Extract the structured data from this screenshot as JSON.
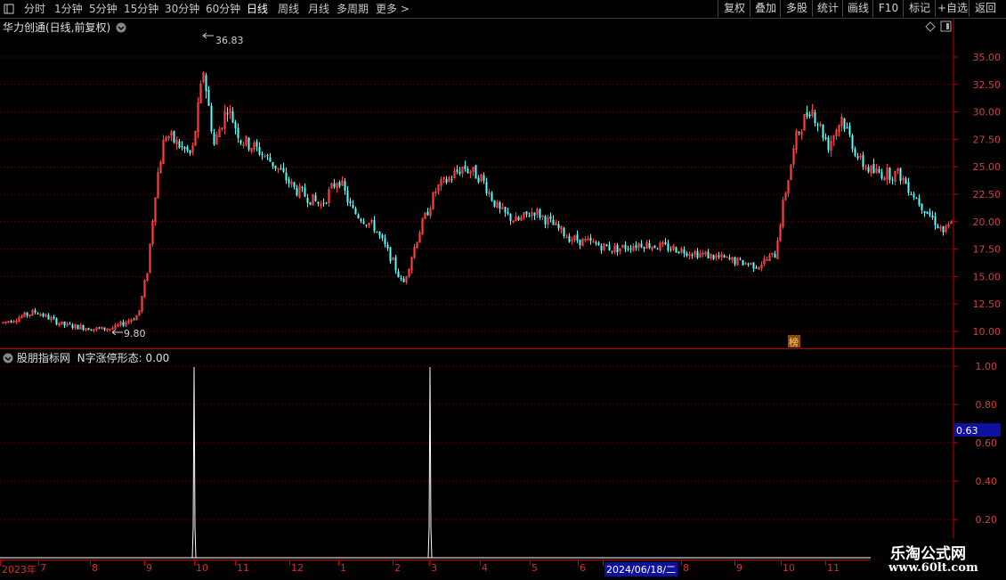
{
  "toolbar": {
    "period_tabs": [
      "分时",
      "1分钟",
      "5分钟",
      "15分钟",
      "30分钟",
      "60分钟",
      "日线",
      "周线",
      "月线",
      "多周期",
      "更多"
    ],
    "active_tab": "日线",
    "right_buttons": [
      "复权",
      "叠加",
      "多股",
      "统计",
      "画线",
      "F10",
      "标记",
      "+自选",
      "返回"
    ]
  },
  "main_panel": {
    "title": "华力创通(日线,前复权)",
    "high_label": "36.83",
    "low_label": "9.80",
    "badge": "榜",
    "y_ticks": [
      "35.00",
      "32.50",
      "30.00",
      "27.50",
      "25.00",
      "22.50",
      "20.00",
      "17.50",
      "15.00",
      "12.50",
      "10.00"
    ]
  },
  "indicator_panel": {
    "title": "股朋指标网",
    "indicator_name": "N字涨停形态:",
    "indicator_value": "0.00",
    "y_ticks": [
      "1.00",
      "0.80",
      "0.60",
      "0.40",
      "0.20"
    ],
    "cursor_value": "0.63"
  },
  "x_axis": {
    "labels": [
      "2023年",
      "7",
      "8",
      "9",
      "10",
      "11",
      "12",
      "1",
      "2",
      "3",
      "4",
      "5",
      "6",
      "2024/06/18/二",
      "8",
      "9",
      "10",
      "11"
    ]
  },
  "watermark": {
    "line1": "乐淘公式网",
    "line2": "www.60lt.com"
  },
  "colors": {
    "up": "#ff3c3c",
    "down": "#54ffff",
    "axis": "#c00000",
    "grid": "#6a0000",
    "highlight_box": "#1010a0"
  },
  "chart_data": {
    "type": "candlestick",
    "price_range": [
      9.8,
      36.83
    ],
    "high": 36.83,
    "low": 9.8,
    "indicator_spikes": [
      {
        "near_label": "10",
        "value": 1.0
      },
      {
        "near_label": "3",
        "value": 1.0
      }
    ],
    "indicator_ylim": [
      0,
      1.0
    ]
  }
}
